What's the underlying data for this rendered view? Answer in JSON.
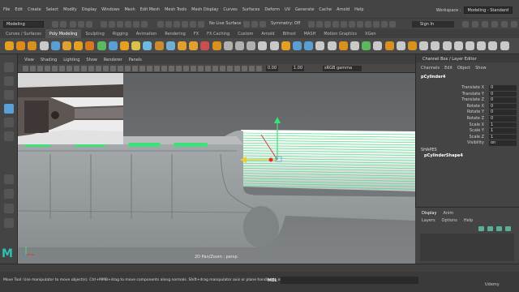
{
  "menubar": {
    "items": [
      "File",
      "Edit",
      "Create",
      "Select",
      "Modify",
      "Display",
      "Windows",
      "Mesh",
      "Edit Mesh",
      "Mesh Tools",
      "Mesh Display",
      "Curves",
      "Surfaces",
      "Deform",
      "UV",
      "Generate",
      "Cache",
      "Arnold",
      "Help"
    ],
    "workspace_label": "Workspace :",
    "workspace_value": "Modeling - Standard"
  },
  "statusline": {
    "mode": "Modeling",
    "live_surface": "No Live Surface",
    "symmetry": "Symmetry: Off",
    "sign_in": "Sign In"
  },
  "shelf": {
    "tabs": [
      "Curves / Surfaces",
      "Poly Modeling",
      "Sculpting",
      "Rigging",
      "Animation",
      "Rendering",
      "FX",
      "FX Caching",
      "Custom",
      "Arnold",
      "Bifrost",
      "MASH",
      "Motion Graphics",
      "XGen"
    ],
    "active_tab": 1,
    "icon_colors": [
      "#e6a020",
      "#e08a18",
      "#d9901c",
      "#c9c9c9",
      "#5a9fd4",
      "#e0a030",
      "#e6a020",
      "#d97a1a",
      "#5cb85c",
      "#5a9fd4",
      "#e6a020",
      "#d9c14a",
      "#6fb8e0",
      "#cc8a2a",
      "#6fb0d0",
      "#e0a030",
      "#e0a030",
      "#c85050",
      "#d9901c",
      "#b0b0b0",
      "#b0b0b0",
      "#b0b0b0",
      "#c9c9c9",
      "#c9c9c9",
      "#e6a020",
      "#5a9fd4",
      "#5a9fd4",
      "#c9c9c9",
      "#c9c9c9",
      "#d9901c",
      "#c9c9c9",
      "#5cb85c",
      "#c9c9c9",
      "#d9901c",
      "#c9c9c9",
      "#d9901c",
      "#c9c9c9",
      "#c9c9c9",
      "#c9c9c9",
      "#c9c9c9",
      "#c9c9c9",
      "#c9c9c9",
      "#c9c9c9",
      "#c9c9c9"
    ]
  },
  "viewport_menu": [
    "View",
    "Shading",
    "Lighting",
    "Show",
    "Renderer",
    "Panels"
  ],
  "viewport_toolbar": {
    "field_1": "0.00",
    "field_2": "1.00",
    "color_space": "sRGB gamma"
  },
  "viewport": {
    "camera_label": "2D Pan/Zoom : persp",
    "selection_color": "#3fe07a",
    "mesh_color": "#9a9fa2"
  },
  "channel_box": {
    "title": "Channel Box / Layer Editor",
    "menus": [
      "Channels",
      "Edit",
      "Object",
      "Show"
    ],
    "object_name": "pCylinder4",
    "attributes": [
      {
        "name": "Translate X",
        "value": "0"
      },
      {
        "name": "Translate Y",
        "value": "0"
      },
      {
        "name": "Translate Z",
        "value": "0"
      },
      {
        "name": "Rotate X",
        "value": "0"
      },
      {
        "name": "Rotate Y",
        "value": "0"
      },
      {
        "name": "Rotate Z",
        "value": "0"
      },
      {
        "name": "Scale X",
        "value": "1"
      },
      {
        "name": "Scale Y",
        "value": "1"
      },
      {
        "name": "Scale Z",
        "value": "1"
      },
      {
        "name": "Visibility",
        "value": "on"
      }
    ],
    "shapes_header": "SHAPES",
    "shape_name": "pCylinderShape4"
  },
  "layer_editor": {
    "tabs": [
      "Display",
      "Anim"
    ],
    "active_tab": 0,
    "menus": [
      "Layers",
      "Options",
      "Help"
    ]
  },
  "command_line": {
    "help_text": "Move Tool: Use manipulator to move object(s). Ctrl+MMB+drag to move components along normals. Shift+drag manipulator axis or plane handles to extrude components or clone objects.",
    "mel_label": "MEL"
  },
  "watermark": "Udemy"
}
